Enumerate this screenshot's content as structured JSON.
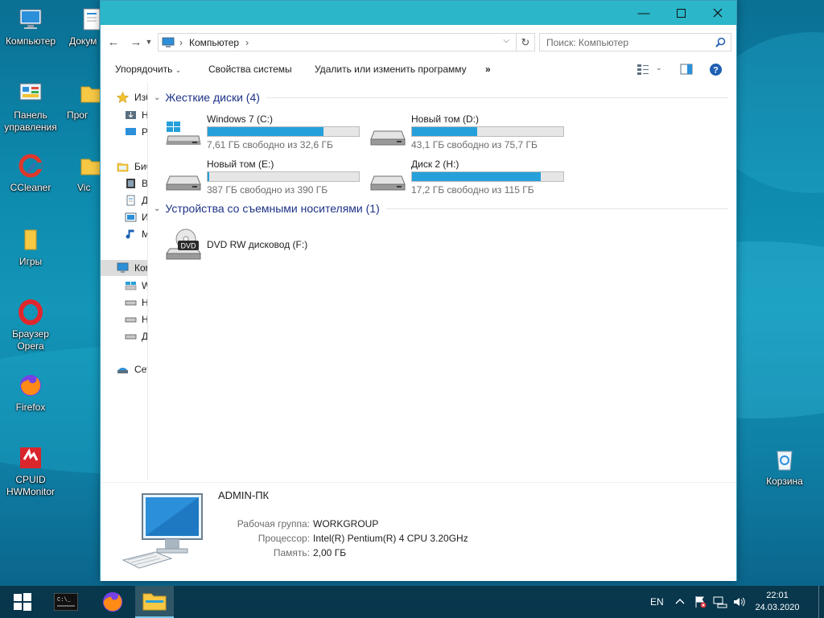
{
  "desktop": {
    "icons": [
      {
        "label": "Компьютер",
        "icon": "computer-icon"
      },
      {
        "label": "Докум",
        "icon": "documents-icon"
      },
      {
        "label": "Панель управления",
        "icon": "control-panel-icon"
      },
      {
        "label": "Прог",
        "icon": "folder-icon"
      },
      {
        "label": "CCleaner",
        "icon": "ccleaner-icon"
      },
      {
        "label": "Vic",
        "icon": "folder-icon"
      },
      {
        "label": "Игры",
        "icon": "folder-icon"
      },
      {
        "label": "Браузер Opera",
        "icon": "opera-icon"
      },
      {
        "label": "Firefox",
        "icon": "firefox-icon"
      },
      {
        "label": "CPUID HWMonitor",
        "icon": "hwmonitor-icon"
      },
      {
        "label": "Корзина",
        "icon": "recycle-bin-icon"
      }
    ]
  },
  "window": {
    "address": "Компьютер",
    "search_placeholder": "Поиск: Компьютер",
    "commands": [
      "Упорядочить",
      "Свойства системы",
      "Удалить или изменить программу",
      "»"
    ],
    "nav": [
      {
        "label": "Изб",
        "icon": "star-icon"
      },
      {
        "label": "Н",
        "icon": "downloads-icon"
      },
      {
        "label": "Р",
        "icon": "desktop-icon"
      },
      {
        "label": "Биб",
        "icon": "libraries-icon"
      },
      {
        "label": "В",
        "icon": "video-icon"
      },
      {
        "label": "Д",
        "icon": "documents-icon"
      },
      {
        "label": "И",
        "icon": "images-icon"
      },
      {
        "label": "М",
        "icon": "music-icon"
      },
      {
        "label": "Ком",
        "icon": "computer-icon"
      },
      {
        "label": "W",
        "icon": "windows-drive-icon"
      },
      {
        "label": "Н",
        "icon": "drive-icon"
      },
      {
        "label": "Н",
        "icon": "drive-icon"
      },
      {
        "label": "Д",
        "icon": "drive-icon"
      },
      {
        "label": "Сет",
        "icon": "network-icon"
      }
    ],
    "groups": {
      "hard_drives_title": "Жесткие диски (4)",
      "removable_title": "Устройства со съемными носителями (1)"
    },
    "drives": [
      {
        "name": "Windows 7 (C:)",
        "free": "7,61 ГБ свободно из 32,6 ГБ",
        "used_fraction": 0.767,
        "icon": "windows-drive-icon"
      },
      {
        "name": "Новый том (D:)",
        "free": "43,1 ГБ свободно из 75,7 ГБ",
        "used_fraction": 0.431,
        "icon": "drive-icon"
      },
      {
        "name": "Новый том (E:)",
        "free": "387 ГБ свободно из 390 ГБ",
        "used_fraction": 0.008,
        "icon": "drive-icon"
      },
      {
        "name": "Диск 2 (H:)",
        "free": "17,2 ГБ свободно из 115 ГБ",
        "used_fraction": 0.85,
        "icon": "drive-icon"
      }
    ],
    "removable": [
      {
        "name": "DVD RW дисковод (F:)",
        "icon": "dvd-drive-icon",
        "badge": "DVD"
      }
    ],
    "details": {
      "computer_name": "ADMIN-ПК",
      "workgroup_label": "Рабочая группа:",
      "workgroup_value": "WORKGROUP",
      "cpu_label": "Процессор:",
      "cpu_value": "Intel(R) Pentium(R) 4 CPU 3.20GHz",
      "ram_label": "Память:",
      "ram_value": "2,00 ГБ"
    }
  },
  "taskbar": {
    "lang": "EN",
    "time": "22:01",
    "date": "24.03.2020"
  },
  "colors": {
    "titlebar": "#2bb6c9",
    "bar_fill": "#26a0da",
    "group_heading": "#1e3287"
  }
}
